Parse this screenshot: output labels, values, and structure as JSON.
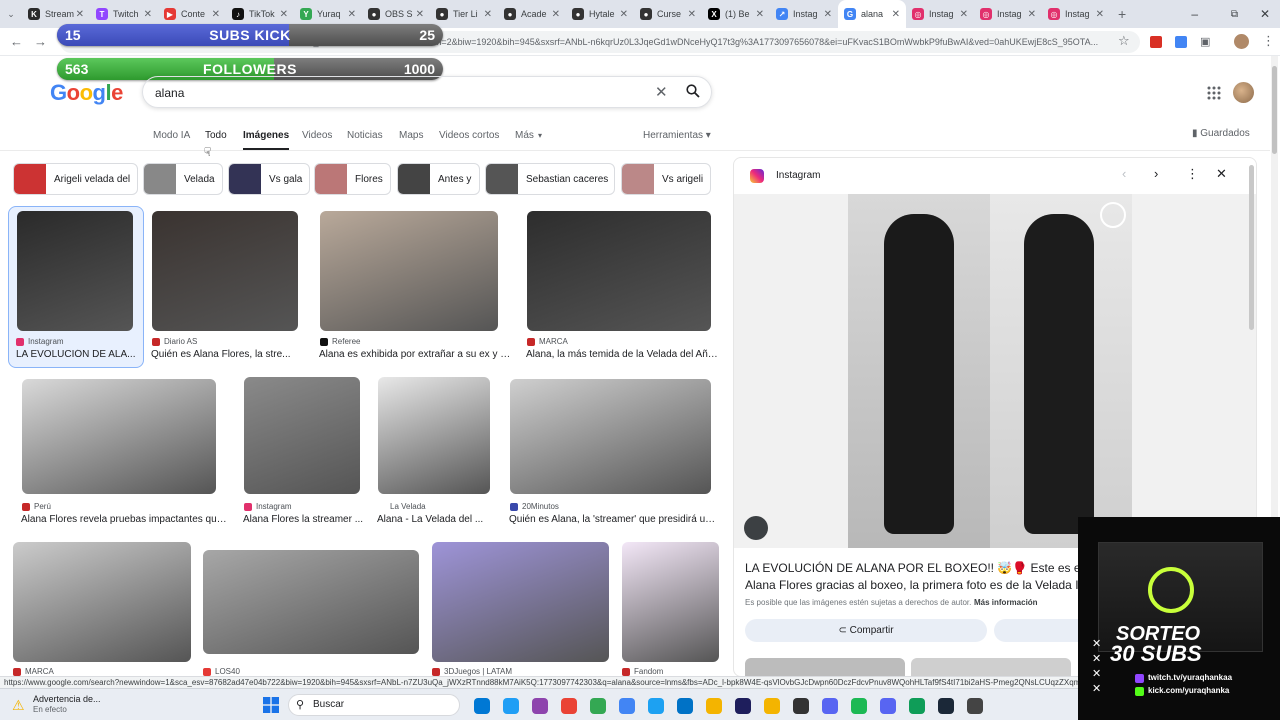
{
  "tabs": [
    {
      "label": "Stream",
      "color": "#2b2b2b",
      "glyph": "K"
    },
    {
      "label": "Twitch",
      "color": "#9146ff",
      "glyph": "T"
    },
    {
      "label": "Conte",
      "color": "#e53935",
      "glyph": "▶"
    },
    {
      "label": "TikTok",
      "color": "#111111",
      "glyph": "♪"
    },
    {
      "label": "Yuraq",
      "color": "#34a853",
      "glyph": "Y"
    },
    {
      "label": "OBS S",
      "color": "#333333",
      "glyph": "●"
    },
    {
      "label": "Tier Li",
      "color": "#333333",
      "glyph": "●"
    },
    {
      "label": "Acade",
      "color": "#333333",
      "glyph": "●"
    },
    {
      "label": "Hytale",
      "color": "#333333",
      "glyph": "●"
    },
    {
      "label": "Curse",
      "color": "#333333",
      "glyph": "●"
    },
    {
      "label": "(1) Be",
      "color": "#000000",
      "glyph": "X"
    },
    {
      "label": "Instag",
      "color": "#4285f4",
      "glyph": "↗"
    },
    {
      "label": "alana",
      "color": "#4285f4",
      "glyph": "G"
    },
    {
      "label": "Instag",
      "color": "#e1306c",
      "glyph": "◎"
    },
    {
      "label": "Instag",
      "color": "#e1306c",
      "glyph": "◎"
    },
    {
      "label": "Instag",
      "color": "#e1306c",
      "glyph": "◎"
    }
  ],
  "address": {
    "url": "fo&sca_esv=87682ad47e04b722&udm=2&biw=1920&bih=945&sxsrf=ANbL-n6kqrUz0L3JqeGd1wDNceHyQ17t3g%3A1773097656078&ei=uFKvacS1BOmWwbkP9fuBwAI&ved=0ahUKEwjE8cS_95OTA..."
  },
  "overlays": {
    "subs": {
      "current": "15",
      "label": "SUBS KICK",
      "goal": "25",
      "progress": 0.6
    },
    "followers": {
      "current": "563",
      "label": "FOLLOWERS",
      "goal": "1000",
      "progress": 0.563
    }
  },
  "google": {
    "logo": "Google",
    "query": "alana",
    "nav": [
      "Modo IA",
      "Todo",
      "Imágenes",
      "Videos",
      "Noticias",
      "Maps",
      "Videos cortos",
      "Más"
    ],
    "tools": "Herramientas",
    "saved": "Guardados"
  },
  "chips": [
    "Arigeli velada del",
    "Velada",
    "Vs gala",
    "Flores",
    "Antes y",
    "Sebastian caceres",
    "Vs arigeli"
  ],
  "results": [
    {
      "source": "Instagram",
      "title": "LA EVOLUCIÓN DE ALA..."
    },
    {
      "source": "Diario AS",
      "title": "Quién es Alana Flores, la stre..."
    },
    {
      "source": "Referee",
      "title": "Alana es exhibida por extrañar a su ex y u..."
    },
    {
      "source": "MARCA",
      "title": "Alana, la más temida de la Velada del Año ..."
    },
    {
      "source": "Perú",
      "title": "Alana Flores revela pruebas impactantes que ..."
    },
    {
      "source": "Instagram",
      "title": "Alana Flores la streamer ..."
    },
    {
      "source": "La Velada",
      "title": "Alana - La Velada del ..."
    },
    {
      "source": "20Minutos",
      "title": "Quién es Alana, la 'streamer' que presidirá un ..."
    },
    {
      "source": "MARCA",
      "title": ""
    },
    {
      "source": "LOS40",
      "title": ""
    },
    {
      "source": "3DJuegos | LATAM",
      "title": ""
    },
    {
      "source": "Fandom",
      "title": ""
    }
  ],
  "panel": {
    "source": "Instagram",
    "title": "LA EVOLUCIÓN DE ALANA POR EL BOXEO!! 🤯🥊 Este es el c",
    "title2": "Alana Flores gracias al boxeo, la primera foto es de la Velada IV",
    "copyright": "Es posible que las imágenes estén sujetas a derechos de autor.",
    "more": "Más información",
    "share": "Compartir"
  },
  "status_url": "https://www.google.com/search?newwindow=1&sca_esv=87682ad47e04b722&biw=1920&bih=945&sxsrf=ANbL-n7ZU3uQa_jWXzRTnnd88kM7AiK5Q:1773097742303&q=alana&source=lnms&fbs=ADc_l-bpk8W4E-qsVlOvbGJcDwpn60DczFdcvPnuv8WQohHLTaf9fS4tI71bi2aHS-Pmeg2QNsLCUqzZXqmjXD",
  "taskbar": {
    "warning_title": "Advertencia de...",
    "warning_sub": "En efecto",
    "search": "Buscar"
  },
  "sorteo": {
    "line1": "SORTEO",
    "line2": "30 SUBS",
    "twitch": "twitch.tv/yuraqhankaa",
    "kick": "kick.com/yuraqhanka"
  }
}
